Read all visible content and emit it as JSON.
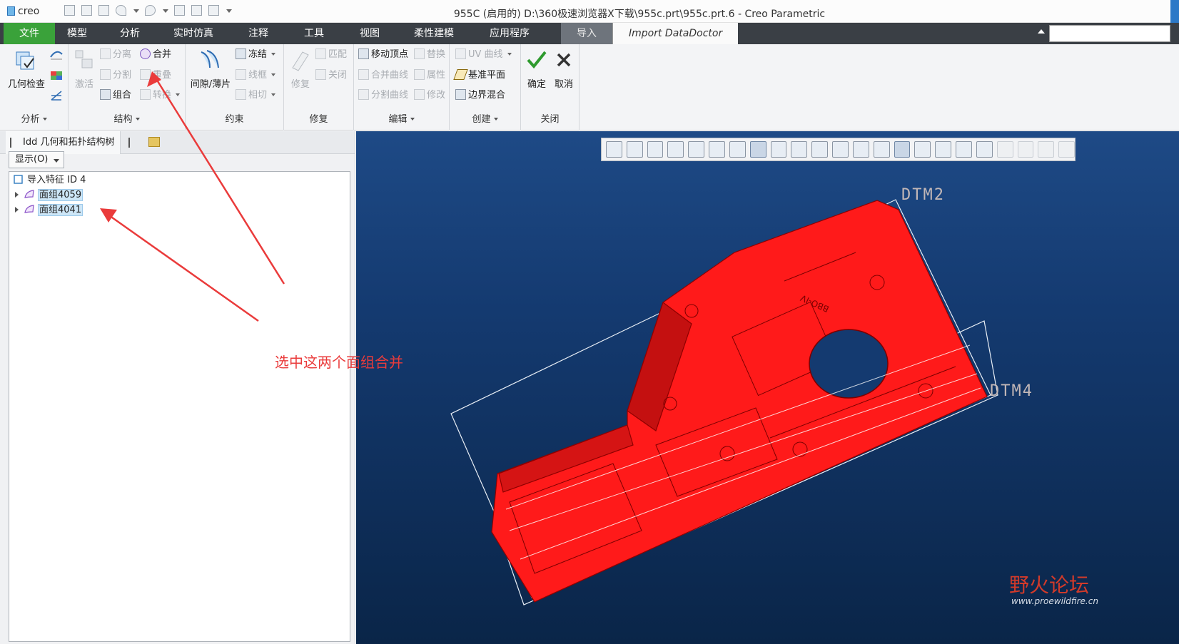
{
  "titlebar": {
    "logo": "creo",
    "title": "955C (启用的) D:\\360极速浏览器X下载\\955c.prt\\955c.prt.6 - Creo Parametric"
  },
  "tabs": {
    "file": "文件",
    "model": "模型",
    "analysis": "分析",
    "simulation": "实时仿真",
    "annotate": "注释",
    "tools": "工具",
    "view": "视图",
    "flexible": "柔性建模",
    "apps": "应用程序",
    "import": "导入",
    "datadoctor": "Import DataDoctor"
  },
  "ribbon": {
    "analysis": {
      "check": "几何检查",
      "label": "分析"
    },
    "structure": {
      "activate": "激活",
      "separate": "分离",
      "split": "分割",
      "combine": "组合",
      "merge": "合并",
      "overlap": "重叠",
      "convert": "转换",
      "label": "结构"
    },
    "constraints": {
      "gap": "间隙/薄片",
      "freeze": "冻结",
      "wireframe": "线框",
      "tangent": "相切",
      "label": "约束"
    },
    "repair": {
      "fix": "修复",
      "match": "匹配",
      "close": "关闭",
      "label": "修复"
    },
    "edit": {
      "move_vertex": "移动顶点",
      "replace": "替换",
      "merge_curve": "合并曲线",
      "attribute": "属性",
      "split_curve": "分割曲线",
      "modify": "修改",
      "label": "编辑"
    },
    "create": {
      "uv_curve": "UV 曲线",
      "datum_plane": "基准平面",
      "boundary_blend": "边界混合",
      "label": "创建"
    },
    "close": {
      "ok": "确定",
      "cancel": "取消",
      "label": "关闭"
    }
  },
  "panel": {
    "tab_label": "Idd 几何和拓扑结构树",
    "show_button": "显示(O)",
    "root": "导入特征 ID 4",
    "items": [
      {
        "label": "面组4059"
      },
      {
        "label": "面组4041"
      }
    ]
  },
  "viewport": {
    "datums": {
      "dtm2": "DTM2",
      "dtm4": "DTM4"
    },
    "part_engraving": "BBO-IV",
    "watermark": {
      "title": "野火论坛",
      "url": "www.proewildfire.cn"
    }
  },
  "annotation": {
    "text": "选中这两个面组合并",
    "color": "#ea3b3b"
  },
  "colors": {
    "file_tab": "#3aa23a",
    "part": "#ff1a1a",
    "viewport_bg": "#143a70"
  }
}
